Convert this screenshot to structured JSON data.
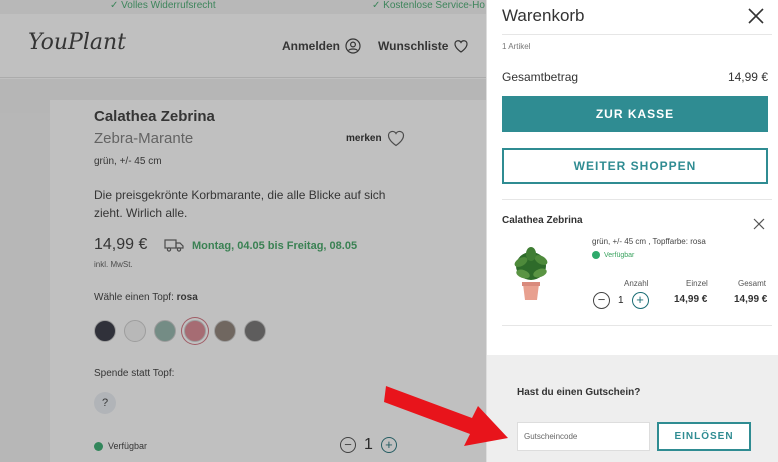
{
  "topbar": {
    "usp_1": "Volles Widerrufsrecht",
    "usp_2": "Kostenlose Service-Ho"
  },
  "header": {
    "logo": "YouPlant",
    "login_label": "Anmelden",
    "wishlist_label": "Wunschliste"
  },
  "product": {
    "title": "Calathea Zebrina",
    "subtitle": "Zebra-Marante",
    "bookmark_label": "merken",
    "meta": "grün, +/- 45 cm",
    "description": "Die preisgekrönte Korbmarante, die alle Blicke auf sich zieht. Wirlich alle.",
    "price": "14,99 €",
    "vat_note": "inkl. MwSt.",
    "delivery": "Montag, 04.05 bis Freitag, 08.05",
    "pot_label": "Wähle einen Topf:",
    "pot_selected": "rosa",
    "pot_colors": [
      "#2b2d3a",
      "#f4f4f4",
      "#8fb3a8",
      "#d9838e",
      "#8a7c72",
      "#6f6d6d"
    ],
    "donate_label": "Spende statt Topf:",
    "help_symbol": "?",
    "availability": "Verfügbar",
    "quantity": "1",
    "minus": "−",
    "plus": "+"
  },
  "cart": {
    "title": "Warenkorb",
    "item_count": "1 Artikel",
    "total_label": "Gesamtbetrag",
    "total_value": "14,99 €",
    "checkout_button": "ZUR KASSE",
    "continue_button": "WEITER SHOPPEN",
    "item": {
      "name": "Calathea Zebrina",
      "variant": "grün, +/- 45 cm , Topffarbe: rosa",
      "availability": "Verfügbar",
      "qty_header": "Anzahl",
      "unit_header": "Einzel",
      "total_header": "Gesamt",
      "quantity": "1",
      "unit_price": "14,99 €",
      "total_price": "14,99 €"
    },
    "voucher": {
      "question": "Hast du einen Gutschein?",
      "placeholder": "Gutscheincode",
      "button": "EINLÖSEN"
    }
  },
  "colors": {
    "accent": "#2f8c92",
    "available": "#2eaa6b",
    "arrow": "#e8141b"
  }
}
